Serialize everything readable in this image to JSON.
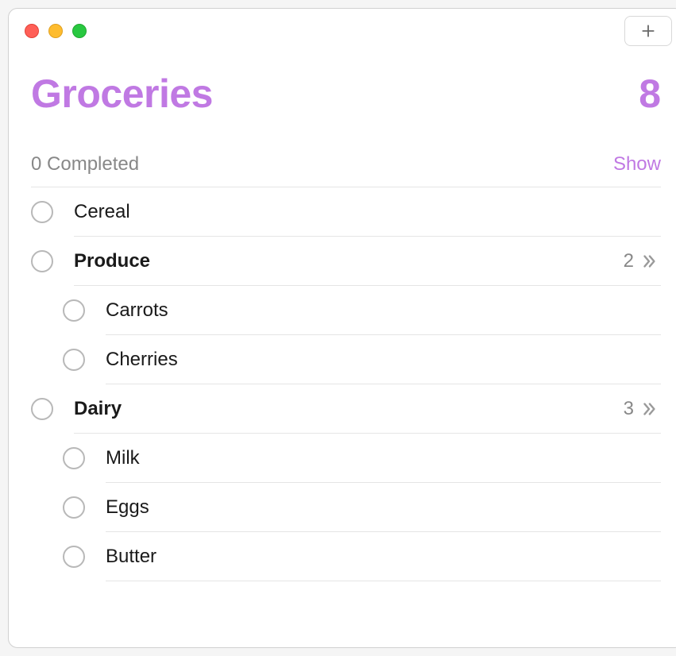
{
  "accent_color": "#c079e3",
  "list": {
    "title": "Groceries",
    "count": "8",
    "completed_text": "0 Completed",
    "show_label": "Show"
  },
  "items": [
    {
      "label": "Cereal",
      "bold": false,
      "subcount": null,
      "sub": false
    },
    {
      "label": "Produce",
      "bold": true,
      "subcount": "2",
      "sub": false
    },
    {
      "label": "Carrots",
      "bold": false,
      "subcount": null,
      "sub": true
    },
    {
      "label": "Cherries",
      "bold": false,
      "subcount": null,
      "sub": true
    },
    {
      "label": "Dairy",
      "bold": true,
      "subcount": "3",
      "sub": false
    },
    {
      "label": "Milk",
      "bold": false,
      "subcount": null,
      "sub": true
    },
    {
      "label": "Eggs",
      "bold": false,
      "subcount": null,
      "sub": true
    },
    {
      "label": "Butter",
      "bold": false,
      "subcount": null,
      "sub": true
    }
  ]
}
